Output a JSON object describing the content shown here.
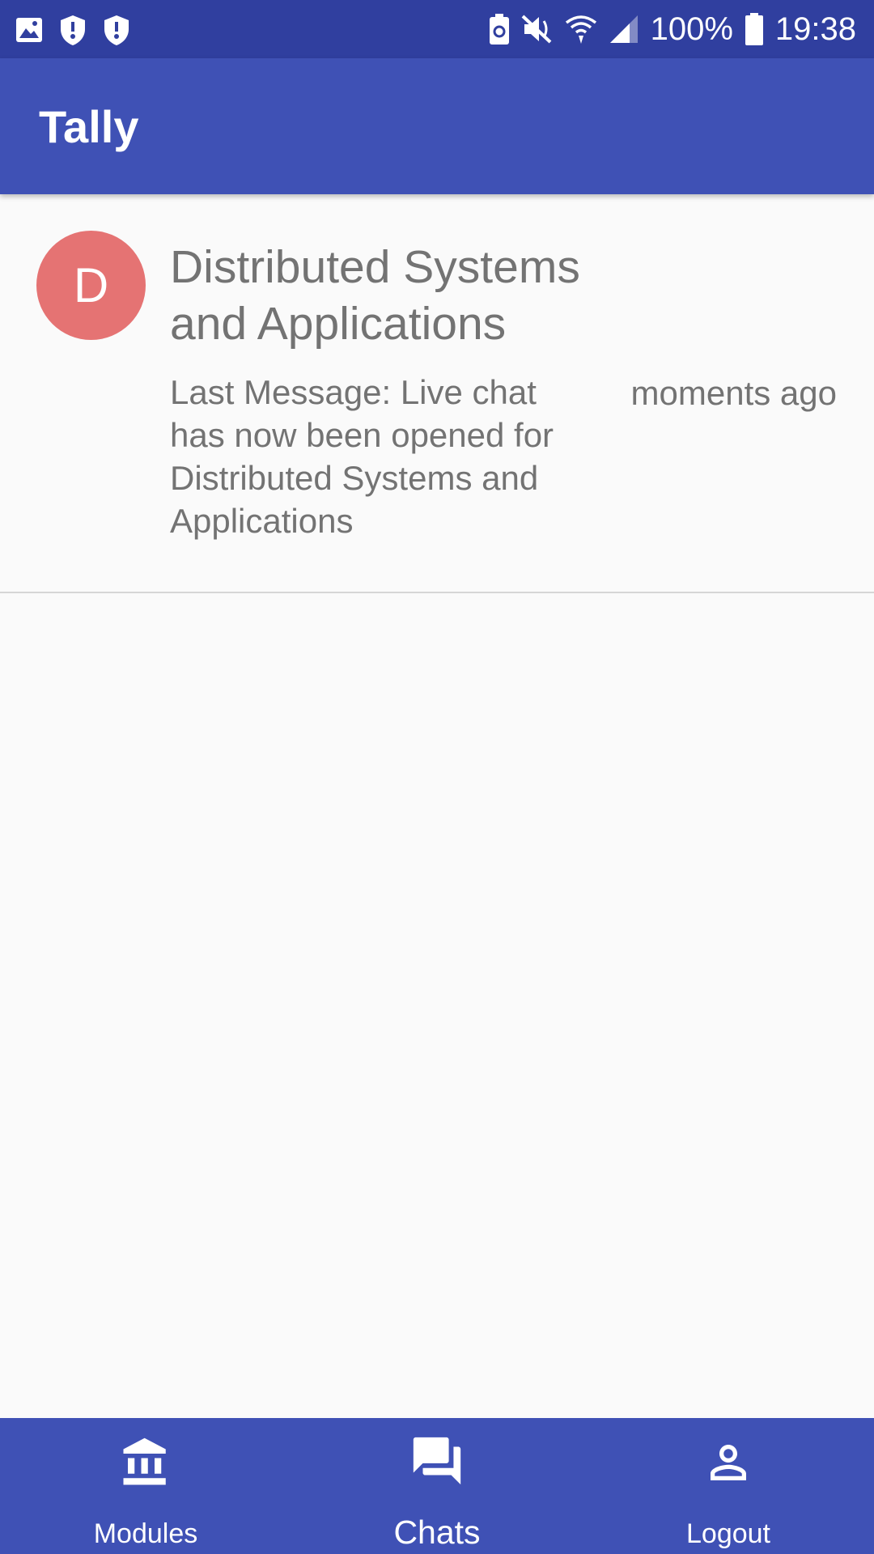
{
  "status_bar": {
    "battery": "100%",
    "time": "19:38",
    "left_icons": [
      "gallery-icon",
      "shield-icon",
      "shield-icon"
    ],
    "right_icons": [
      "battery-saver-icon",
      "mute-icon",
      "wifi-icon",
      "signal-icon",
      "battery-icon"
    ]
  },
  "app_bar": {
    "title": "Tally"
  },
  "chats": [
    {
      "avatar_letter": "D",
      "avatar_color": "#e57373",
      "title": "Distributed Systems and Applications",
      "last_message": "Last Message: Live chat has now been opened for Distributed Systems and Applications",
      "time": "moments ago"
    }
  ],
  "bottom_nav": {
    "items": [
      {
        "label": "Modules",
        "icon": "bank-icon"
      },
      {
        "label": "Chats",
        "icon": "forum-icon",
        "active": true
      },
      {
        "label": "Logout",
        "icon": "person-icon"
      }
    ]
  },
  "colors": {
    "primary": "#3f51b5",
    "primary_dark": "#303f9f",
    "text_secondary": "#737373"
  }
}
